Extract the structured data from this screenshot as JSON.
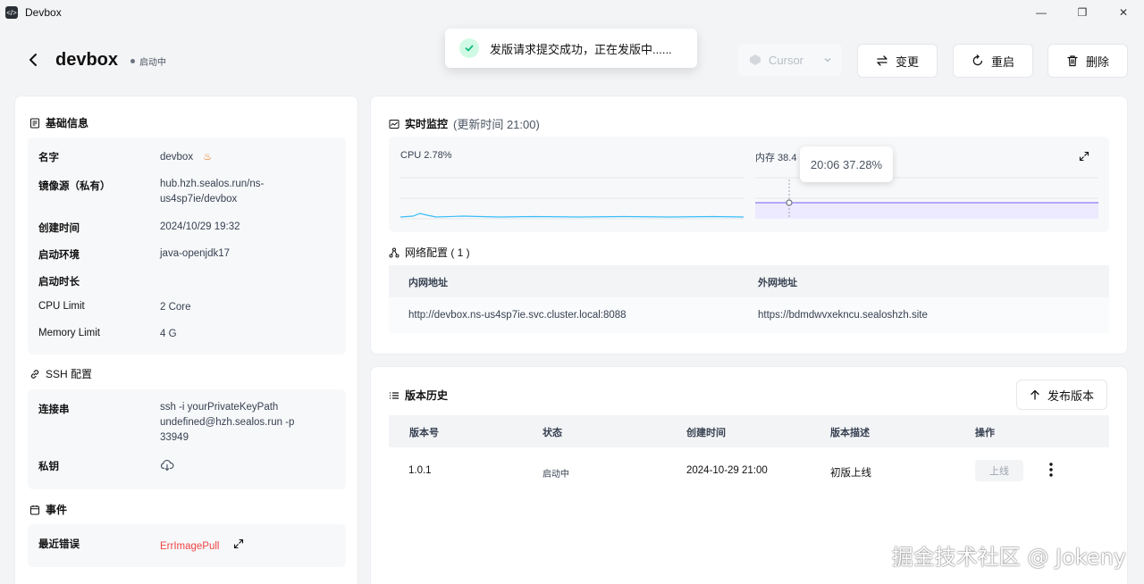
{
  "window": {
    "title": "Devbox",
    "minimize": "—",
    "restore": "❐",
    "close": "✕"
  },
  "header": {
    "title": "devbox",
    "status": "启动中",
    "ide": "Cursor",
    "buttons": {
      "change": "变更",
      "restart": "重启",
      "delete": "删除"
    }
  },
  "toast": {
    "message": "发版请求提交成功，正在发版中......"
  },
  "basic_info": {
    "title": "基础信息",
    "fields": [
      {
        "label": "名字",
        "value": "devbox"
      },
      {
        "label": "镜像源（私有）",
        "value": "hub.hzh.sealos.run/ns-us4sp7ie/devbox"
      },
      {
        "label": "创建时间",
        "value": "2024/10/29 19:32"
      },
      {
        "label": "启动环境",
        "value": "java-openjdk17"
      },
      {
        "label": "启动时长",
        "value": ""
      },
      {
        "label": "CPU Limit",
        "value": "2 Core"
      },
      {
        "label": "Memory Limit",
        "value": "4 G"
      }
    ]
  },
  "ssh": {
    "title": "SSH 配置",
    "connection_label": "连接串",
    "connection_value": "ssh -i yourPrivateKeyPath undefined@hzh.sealos.run -p 33949",
    "key_label": "私钥"
  },
  "events": {
    "title": "事件",
    "recent_error_label": "最近错误",
    "recent_error_value": "ErrImagePull"
  },
  "monitor": {
    "title": "实时监控",
    "updated": "(更新时间  21:00)",
    "cpu_label": "CPU 2.78%",
    "mem_label": "内存 38.4",
    "tooltip": "20:06 37.28%",
    "colors": {
      "cpu": "#38bdf8",
      "mem": "#8b7cf6"
    }
  },
  "network": {
    "title": "网络配置 ( 1 )",
    "headers": [
      "内网地址",
      "外网地址"
    ],
    "rows": [
      [
        "http://devbox.ns-us4sp7ie.svc.cluster.local:8088",
        "https://bdmdwvxekncu.sealoshzh.site"
      ]
    ]
  },
  "versions": {
    "title": "版本历史",
    "publish_button": "发布版本",
    "headers": [
      "版本号",
      "状态",
      "创建时间",
      "版本描述",
      "操作"
    ],
    "rows": [
      {
        "version": "1.0.1",
        "status": "启动中",
        "created": "2024-10-29 21:00",
        "desc": "初版上线",
        "action": "上线"
      }
    ]
  },
  "watermark": "掘金技术社区 @ Jokeny"
}
